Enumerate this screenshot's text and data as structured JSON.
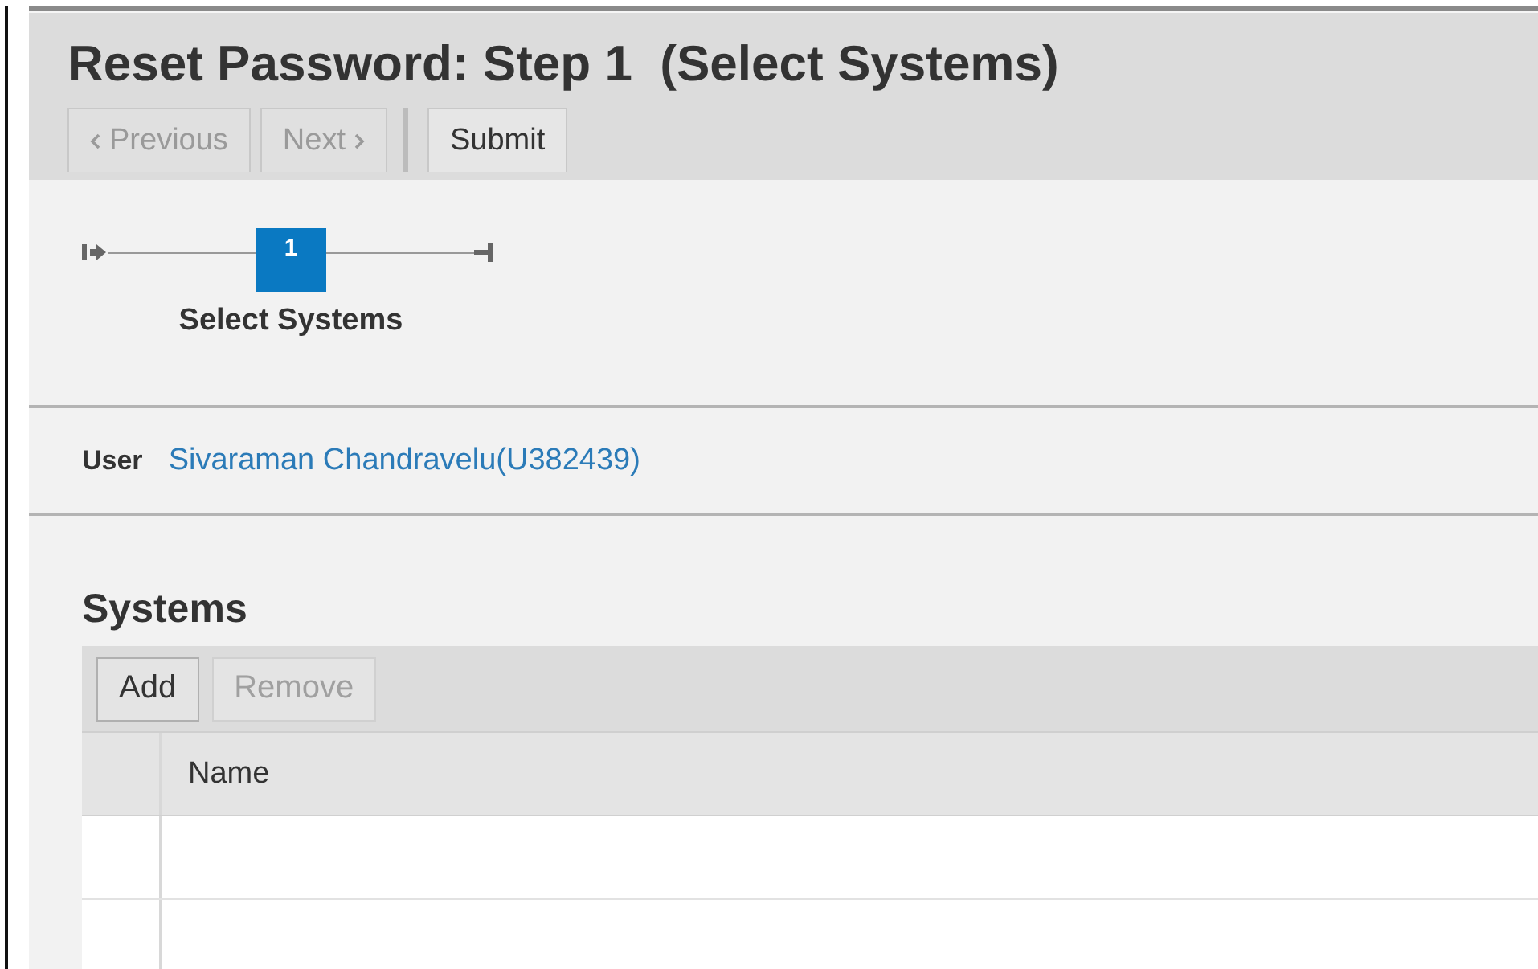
{
  "page": {
    "title": "Reset Password: Step 1  (Select Systems)"
  },
  "toolbar": [
    {
      "label": "Previous",
      "kind": "prev",
      "disabled": true
    },
    {
      "label": "Next",
      "kind": "next",
      "disabled": true
    },
    {
      "label": "Submit",
      "kind": "plain",
      "disabled": false
    }
  ],
  "steps": [
    {
      "number": "1",
      "label": "Select Systems",
      "selected": true
    }
  ],
  "user": {
    "label": "User",
    "value": "Sivaraman Chandravelu(U382439)"
  },
  "systems": {
    "title": "Systems",
    "buttons": [
      {
        "label": "Add",
        "disabled": false
      },
      {
        "label": "Remove",
        "disabled": true
      }
    ],
    "columns": [
      "Name"
    ]
  }
}
